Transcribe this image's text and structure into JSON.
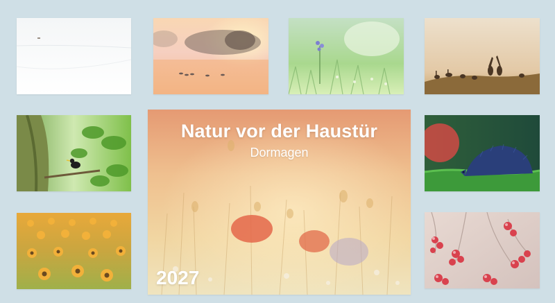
{
  "calendar": {
    "title": "Natur vor der Haustür",
    "subtitle": "Dormagen",
    "year": "2027"
  },
  "background_color": "#cfdfe6",
  "thumbnails": [
    {
      "subject": "snowy-field-with-deer"
    },
    {
      "subject": "misty-lake-sunrise-with-ducks"
    },
    {
      "subject": "meadow-with-blue-flower"
    },
    {
      "subject": "hares-silhouette"
    },
    {
      "subject": "bird-on-tree-branch"
    },
    {
      "subject": "hedgehog-on-grass"
    },
    {
      "subject": "sunflower-field"
    },
    {
      "subject": "frosted-red-berries"
    }
  ]
}
